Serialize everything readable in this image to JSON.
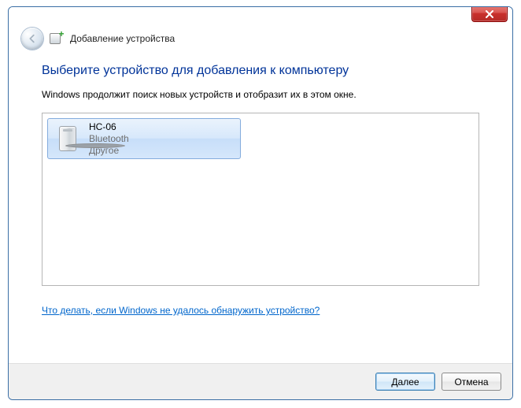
{
  "wizard": {
    "title": "Добавление устройства"
  },
  "main": {
    "heading": "Выберите устройство для добавления к компьютеру",
    "subtext": "Windows продолжит поиск новых устройств и отобразит их в этом окне."
  },
  "devices": [
    {
      "name": "HC-06",
      "type": "Bluetooth",
      "category": "Другое",
      "selected": true
    }
  ],
  "help": {
    "link_text": "Что делать, если Windows не удалось обнаружить устройство?"
  },
  "footer": {
    "next": "Далее",
    "cancel": "Отмена"
  }
}
